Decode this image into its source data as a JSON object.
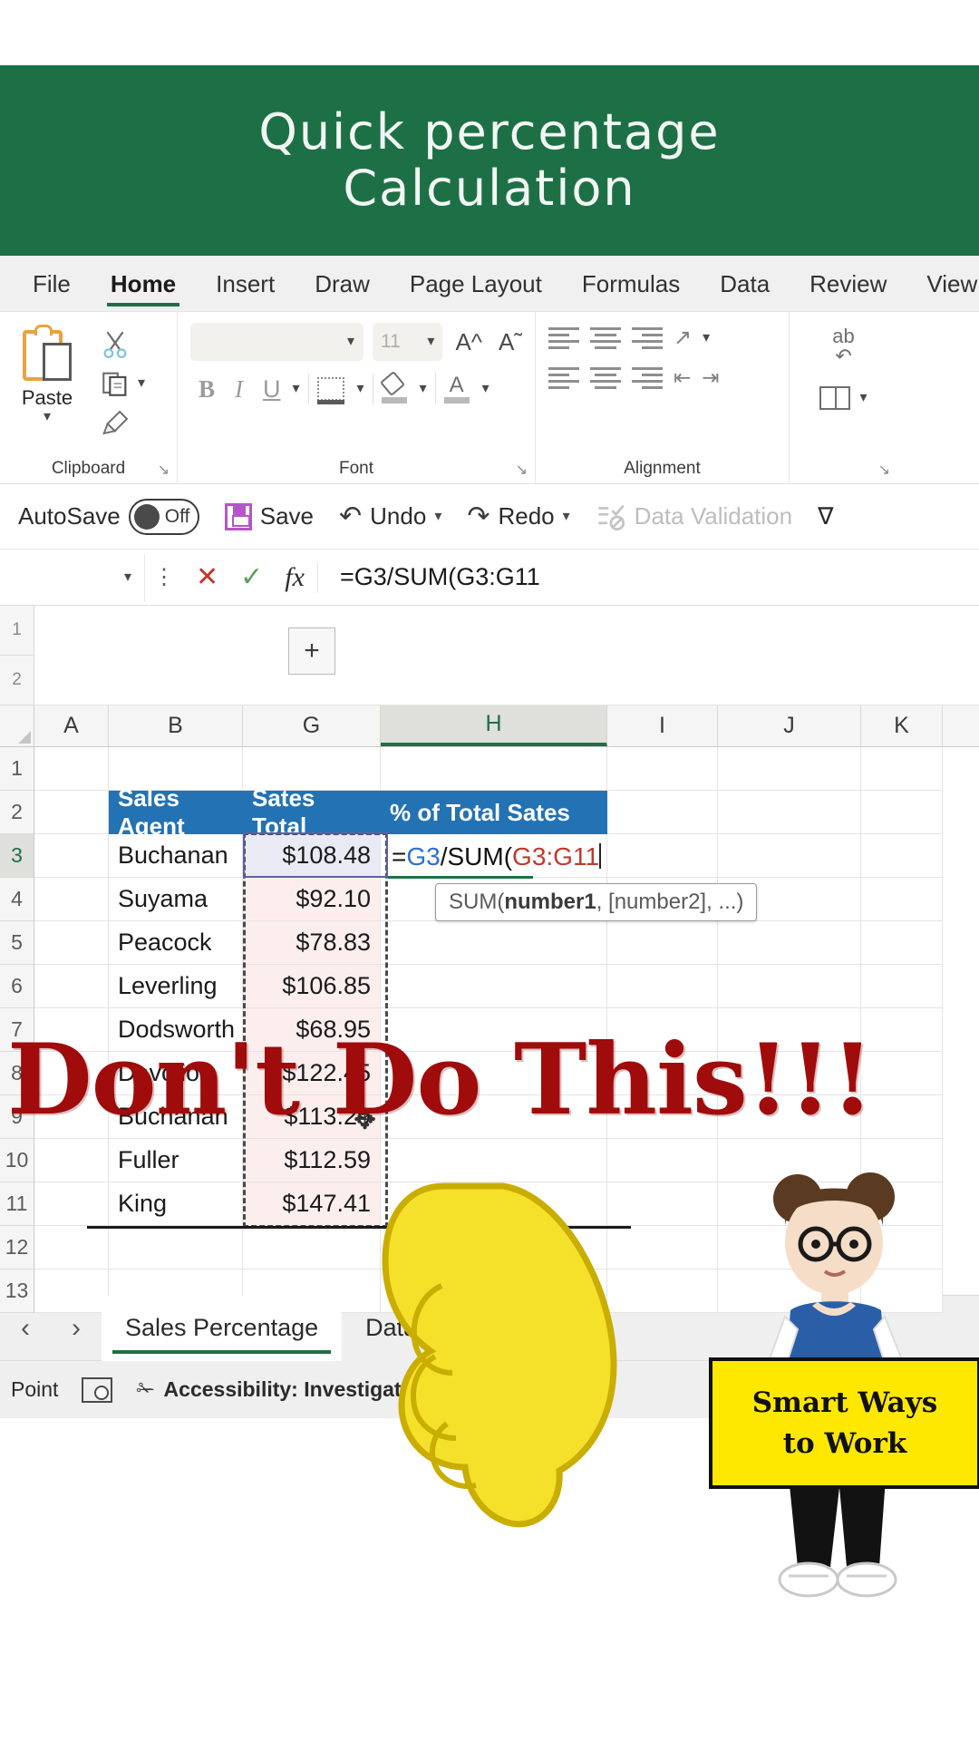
{
  "banner": {
    "line1": "Quick percentage",
    "line2": "Calculation"
  },
  "ribbon": {
    "tabs": [
      {
        "label": "File",
        "active": false
      },
      {
        "label": "Home",
        "active": true
      },
      {
        "label": "Insert",
        "active": false
      },
      {
        "label": "Draw",
        "active": false
      },
      {
        "label": "Page Layout",
        "active": false
      },
      {
        "label": "Formulas",
        "active": false
      },
      {
        "label": "Data",
        "active": false
      },
      {
        "label": "Review",
        "active": false
      },
      {
        "label": "View",
        "active": false
      }
    ],
    "groups": {
      "clipboard": {
        "label": "Clipboard",
        "paste_label": "Paste",
        "dialog_launcher": "↘"
      },
      "font": {
        "label": "Font",
        "font_name_value": "",
        "font_size_value": "11",
        "grow_font": "A",
        "shrink_font": "A",
        "bold": "B",
        "italic": "I",
        "underline": "U",
        "dialog_launcher": "↘"
      },
      "alignment": {
        "label": "Alignment",
        "dialog_launcher": "↘"
      }
    }
  },
  "quick_access": {
    "autosave_label": "AutoSave",
    "autosave_state": "Off",
    "save_label": "Save",
    "undo_label": "Undo",
    "redo_label": "Redo",
    "data_validation_label": "Data Validation",
    "more_label": "∇"
  },
  "formula_bar": {
    "name_box_value": "",
    "cancel": "✕",
    "enter": "✓",
    "insert_function": "fx",
    "formula": "=G3/SUM(G3:G11"
  },
  "sheet": {
    "columns": [
      "A",
      "B",
      "G",
      "H",
      "I",
      "J",
      "K"
    ],
    "selected_column": "H",
    "row_numbers": [
      "1",
      "2",
      "3",
      "4",
      "5",
      "6",
      "7",
      "8",
      "9",
      "10",
      "11",
      "12",
      "13"
    ],
    "outline_rows": [
      "1",
      "2"
    ],
    "outline_plus": "+",
    "selected_row": "3",
    "header_row": {
      "sales_agent": "Sales Agent",
      "sales_total": "Sates Total",
      "percent_of_total": "% of Total Sates"
    },
    "data": [
      {
        "row": "3",
        "agent": "Buchanan",
        "total": "$108.48"
      },
      {
        "row": "4",
        "agent": "Suyama",
        "total": "$92.10"
      },
      {
        "row": "5",
        "agent": "Peacock",
        "total": "$78.83"
      },
      {
        "row": "6",
        "agent": "Leverling",
        "total": "$106.85"
      },
      {
        "row": "7",
        "agent": "Dodsworth",
        "total": "$68.95"
      },
      {
        "row": "8",
        "agent": "Davolio",
        "total": "$122.45"
      },
      {
        "row": "9",
        "agent": "Buchanan",
        "total": "$113.29"
      },
      {
        "row": "10",
        "agent": "Fuller",
        "total": "$112.59"
      },
      {
        "row": "11",
        "agent": "King",
        "total": "$147.41"
      }
    ],
    "cell_edit": {
      "prefix": "=",
      "ref1": "G3",
      "operator": "/SUM(",
      "ref2": "G3:G11"
    },
    "tooltip": {
      "prefix": "SUM(",
      "bold_arg": "number1",
      "rest": ", [number2], ...)"
    }
  },
  "sheet_tabs": {
    "prev": "‹",
    "next": "›",
    "tabs": [
      {
        "label": "Sales Percentage",
        "active": true
      },
      {
        "label": "Data Entry",
        "active": false
      }
    ]
  },
  "status_bar": {
    "mode": "Point",
    "macro_record_icon": "record-macro-icon",
    "accessibility": "Accessibility: Investigate"
  },
  "overlays": {
    "warning_text": "Don't Do This!!!",
    "warning_color": "#a00b0b",
    "thumbs_down_color": "#f5e02a",
    "sign_line1": "Smart Ways",
    "sign_line2": "to Work",
    "sign_bg": "#ffe800"
  }
}
